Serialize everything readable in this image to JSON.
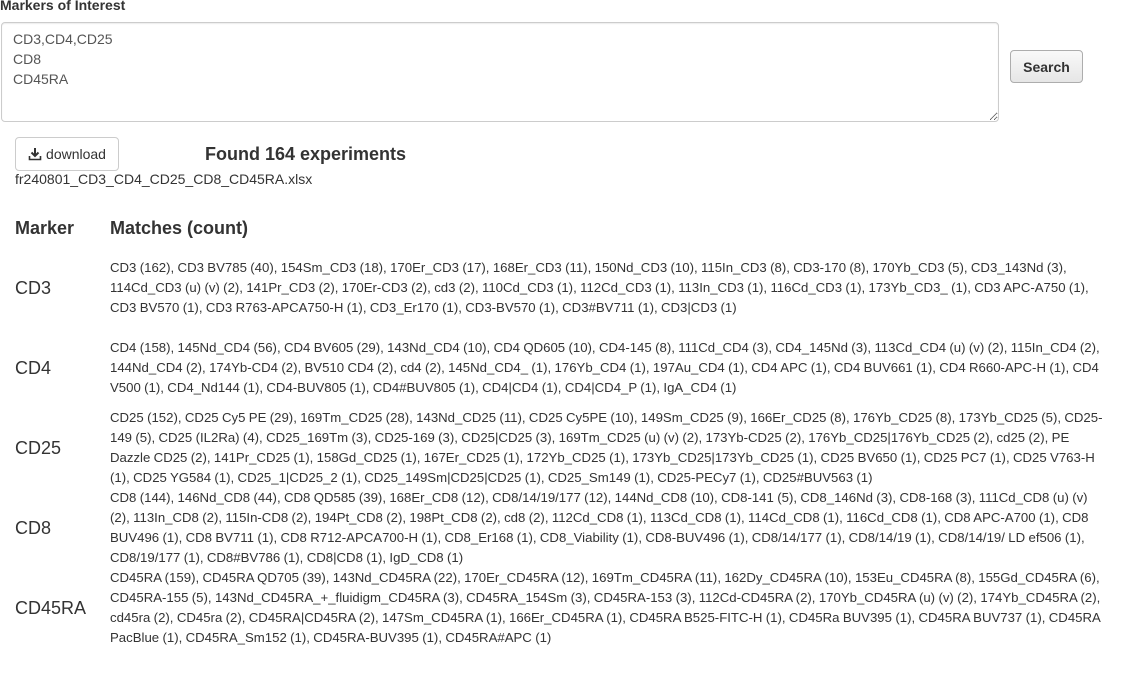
{
  "form": {
    "label": "Markers of Interest",
    "input_value": "CD3,CD4,CD25\nCD8\nCD45RA",
    "search_label": "Search"
  },
  "download": {
    "label": "download",
    "icon": "download-icon"
  },
  "summary": {
    "found_text": "Found 164 experiments",
    "file_name": "fr240801_CD3_CD4_CD25_CD8_CD45RA.xlsx"
  },
  "table": {
    "headers": [
      "Marker",
      "Matches (count)"
    ],
    "rows": [
      {
        "marker": "CD3",
        "matches": "CD3 (162), CD3 BV785 (40), 154Sm_CD3 (18), 170Er_CD3 (17), 168Er_CD3 (11), 150Nd_CD3 (10), 115In_CD3 (8), CD3-170 (8), 170Yb_CD3 (5), CD3_143Nd (3), 114Cd_CD3 (u) (v) (2), 141Pr_CD3 (2), 170Er-CD3 (2), cd3 (2), 110Cd_CD3 (1), 112Cd_CD3 (1), 113In_CD3 (1), 116Cd_CD3 (1), 173Yb_CD3_ (1), CD3 APC-A750 (1), CD3 BV570 (1), CD3 R763-APCA750-H (1), CD3_Er170 (1), CD3-BV570 (1), CD3#BV711 (1), CD3|CD3 (1)"
      },
      {
        "marker": "CD4",
        "matches": "CD4 (158), 145Nd_CD4 (56), CD4 BV605 (29), 143Nd_CD4 (10), CD4 QD605 (10), CD4-145 (8), 111Cd_CD4 (3), CD4_145Nd (3), 113Cd_CD4 (u) (v) (2), 115In_CD4 (2), 144Nd_CD4 (2), 174Yb-CD4 (2), BV510 CD4 (2), cd4 (2), 145Nd_CD4_ (1), 176Yb_CD4 (1), 197Au_CD4 (1), CD4 APC (1), CD4 BUV661 (1), CD4 R660-APC-H (1), CD4 V500 (1), CD4_Nd144 (1), CD4-BUV805 (1), CD4#BUV805 (1), CD4|CD4 (1), CD4|CD4_P (1), IgA_CD4 (1)"
      },
      {
        "marker": "CD25",
        "matches": "CD25 (152), CD25 Cy5 PE (29), 169Tm_CD25 (28), 143Nd_CD25 (11), CD25 Cy5PE (10), 149Sm_CD25 (9), 166Er_CD25 (8), 176Yb_CD25 (8), 173Yb_CD25 (5), CD25-149 (5), CD25 (IL2Ra) (4), CD25_169Tm (3), CD25-169 (3), CD25|CD25 (3), 169Tm_CD25 (u) (v) (2), 173Yb-CD25 (2), 176Yb_CD25|176Yb_CD25 (2), cd25 (2), PE Dazzle CD25 (2), 141Pr_CD25 (1), 158Gd_CD25 (1), 167Er_CD25 (1), 172Yb_CD25 (1), 173Yb_CD25|173Yb_CD25 (1), CD25 BV650 (1), CD25 PC7 (1), CD25 V763-H (1), CD25 YG584 (1), CD25_1|CD25_2 (1), CD25_149Sm|CD25|CD25 (1), CD25_Sm149 (1), CD25-PECy7 (1), CD25#BUV563 (1)"
      },
      {
        "marker": "CD8",
        "matches": "CD8 (144), 146Nd_CD8 (44), CD8 QD585 (39), 168Er_CD8 (12), CD8/14/19/177 (12), 144Nd_CD8 (10), CD8-141 (5), CD8_146Nd (3), CD8-168 (3), 111Cd_CD8 (u) (v) (2), 113In_CD8 (2), 115In-CD8 (2), 194Pt_CD8 (2), 198Pt_CD8 (2), cd8 (2), 112Cd_CD8 (1), 113Cd_CD8 (1), 114Cd_CD8 (1), 116Cd_CD8 (1), CD8 APC-A700 (1), CD8 BUV496 (1), CD8 BV711 (1), CD8 R712-APCA700-H (1), CD8_Er168 (1), CD8_Viability (1), CD8-BUV496 (1), CD8/14/177 (1), CD8/14/19 (1), CD8/14/19/ LD ef506 (1), CD8/19/177 (1), CD8#BV786 (1), CD8|CD8 (1), IgD_CD8 (1)"
      },
      {
        "marker": "CD45RA",
        "matches": "CD45RA (159), CD45RA QD705 (39), 143Nd_CD45RA (22), 170Er_CD45RA (12), 169Tm_CD45RA (11), 162Dy_CD45RA (10), 153Eu_CD45RA (8), 155Gd_CD45RA (6), CD45RA-155 (5), 143Nd_CD45RA_+_fluidigm_CD45RA (3), CD45RA_154Sm (3), CD45RA-153 (3), 112Cd-CD45RA (2), 170Yb_CD45RA (u) (v) (2), 174Yb_CD45RA (2), cd45ra (2), CD45ra (2), CD45RA|CD45RA (2), 147Sm_CD45RA (1), 166Er_CD45RA (1), CD45RA B525-FITC-H (1), CD45Ra BUV395 (1), CD45RA BUV737 (1), CD45RA PacBlue (1), CD45RA_Sm152 (1), CD45RA-BUV395 (1), CD45RA#APC (1)"
      }
    ]
  }
}
